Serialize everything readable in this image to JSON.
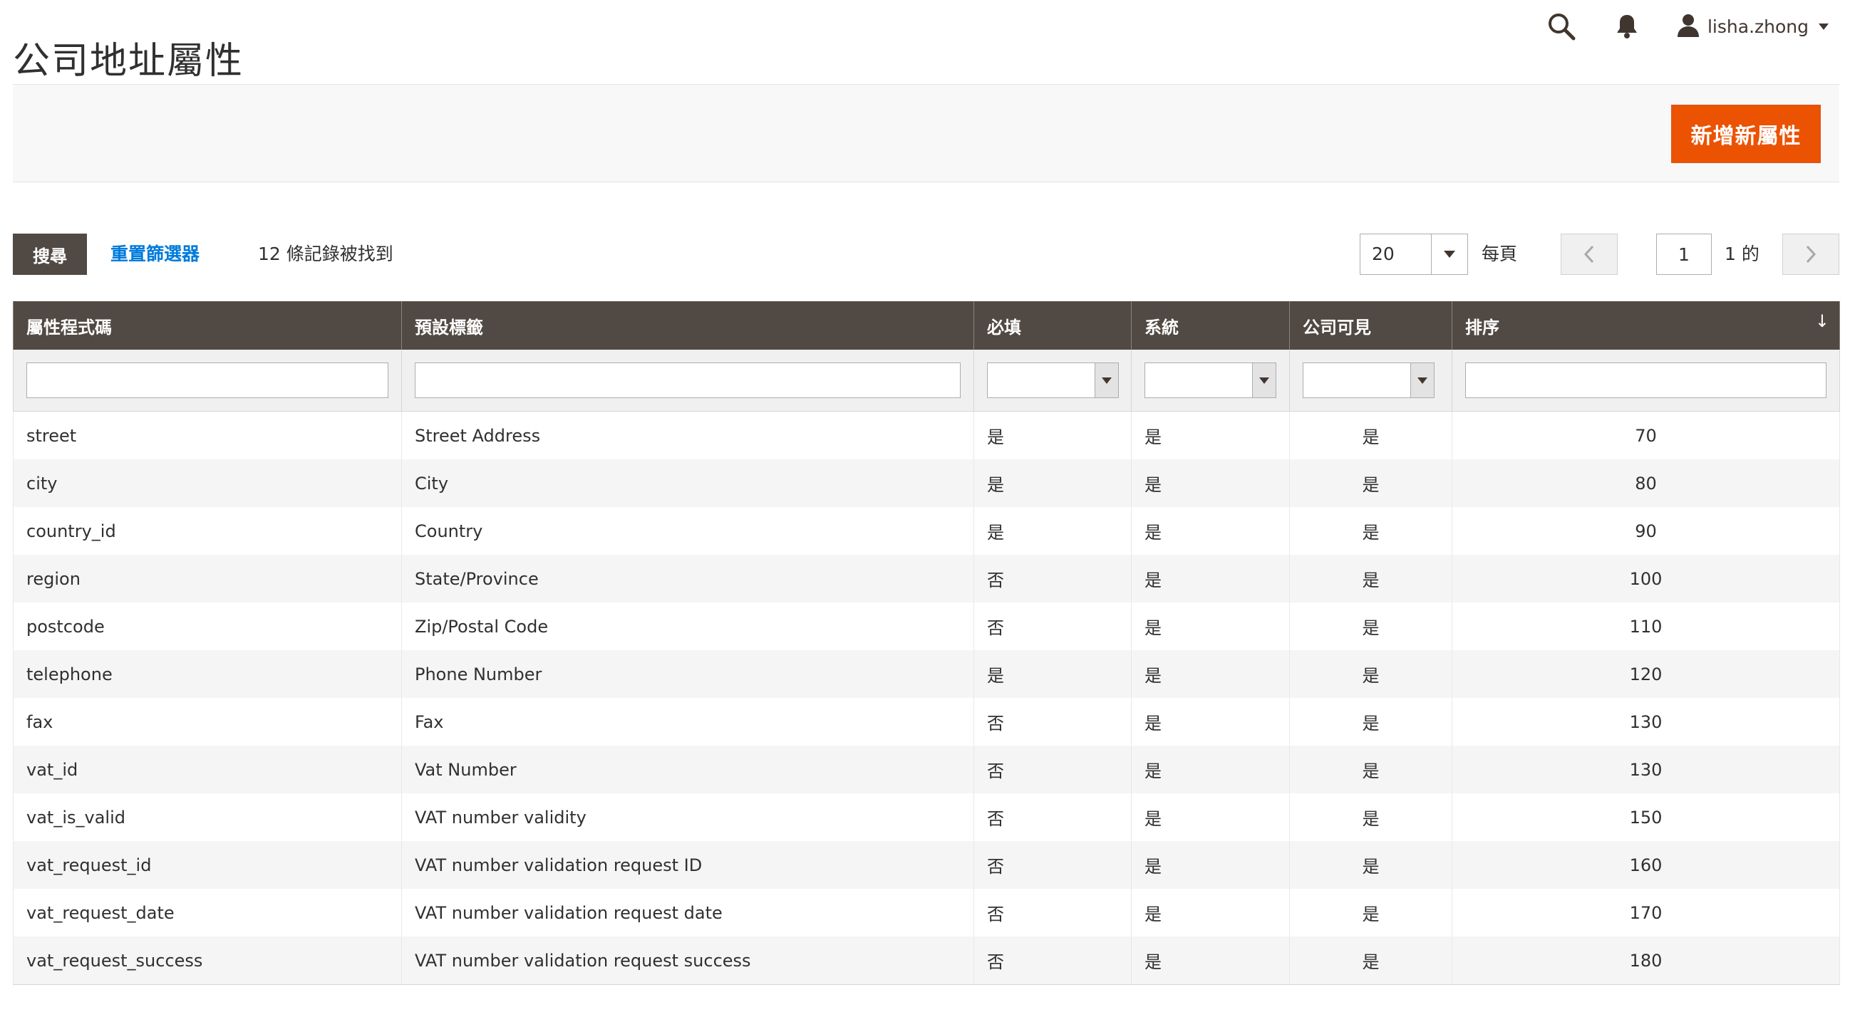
{
  "page": {
    "title": "公司地址屬性"
  },
  "header": {
    "search_icon": "search-icon",
    "notifications_icon": "bell-icon",
    "user_icon": "user-icon",
    "username": "lisha.zhong"
  },
  "action_bar": {
    "add_button_label": "新增新屬性",
    "accent_color": "#eb5202"
  },
  "toolbar": {
    "search_label": "搜尋",
    "reset_label": "重置篩選器",
    "records_found": "12 條記錄被找到",
    "per_page_value": "20",
    "per_page_label": "每頁",
    "current_page": "1",
    "page_of": "1 的"
  },
  "grid": {
    "columns": [
      {
        "label": "屬性程式碼"
      },
      {
        "label": "預設標籤"
      },
      {
        "label": "必填"
      },
      {
        "label": "系統"
      },
      {
        "label": "公司可見"
      },
      {
        "label": "排序",
        "sort_indicator": "↓"
      }
    ],
    "header_color": "#514943",
    "rows": [
      {
        "code": "street",
        "label": "Street Address",
        "required": "是",
        "system": "是",
        "visible": "是",
        "sort": "70"
      },
      {
        "code": "city",
        "label": "City",
        "required": "是",
        "system": "是",
        "visible": "是",
        "sort": "80"
      },
      {
        "code": "country_id",
        "label": "Country",
        "required": "是",
        "system": "是",
        "visible": "是",
        "sort": "90"
      },
      {
        "code": "region",
        "label": "State/Province",
        "required": "否",
        "system": "是",
        "visible": "是",
        "sort": "100"
      },
      {
        "code": "postcode",
        "label": "Zip/Postal Code",
        "required": "否",
        "system": "是",
        "visible": "是",
        "sort": "110"
      },
      {
        "code": "telephone",
        "label": "Phone Number",
        "required": "是",
        "system": "是",
        "visible": "是",
        "sort": "120"
      },
      {
        "code": "fax",
        "label": "Fax",
        "required": "否",
        "system": "是",
        "visible": "是",
        "sort": "130"
      },
      {
        "code": "vat_id",
        "label": "Vat Number",
        "required": "否",
        "system": "是",
        "visible": "是",
        "sort": "130"
      },
      {
        "code": "vat_is_valid",
        "label": "VAT number validity",
        "required": "否",
        "system": "是",
        "visible": "是",
        "sort": "150"
      },
      {
        "code": "vat_request_id",
        "label": "VAT number validation request ID",
        "required": "否",
        "system": "是",
        "visible": "是",
        "sort": "160"
      },
      {
        "code": "vat_request_date",
        "label": "VAT number validation request date",
        "required": "否",
        "system": "是",
        "visible": "是",
        "sort": "170"
      },
      {
        "code": "vat_request_success",
        "label": "VAT number validation request success",
        "required": "否",
        "system": "是",
        "visible": "是",
        "sort": "180"
      }
    ]
  }
}
